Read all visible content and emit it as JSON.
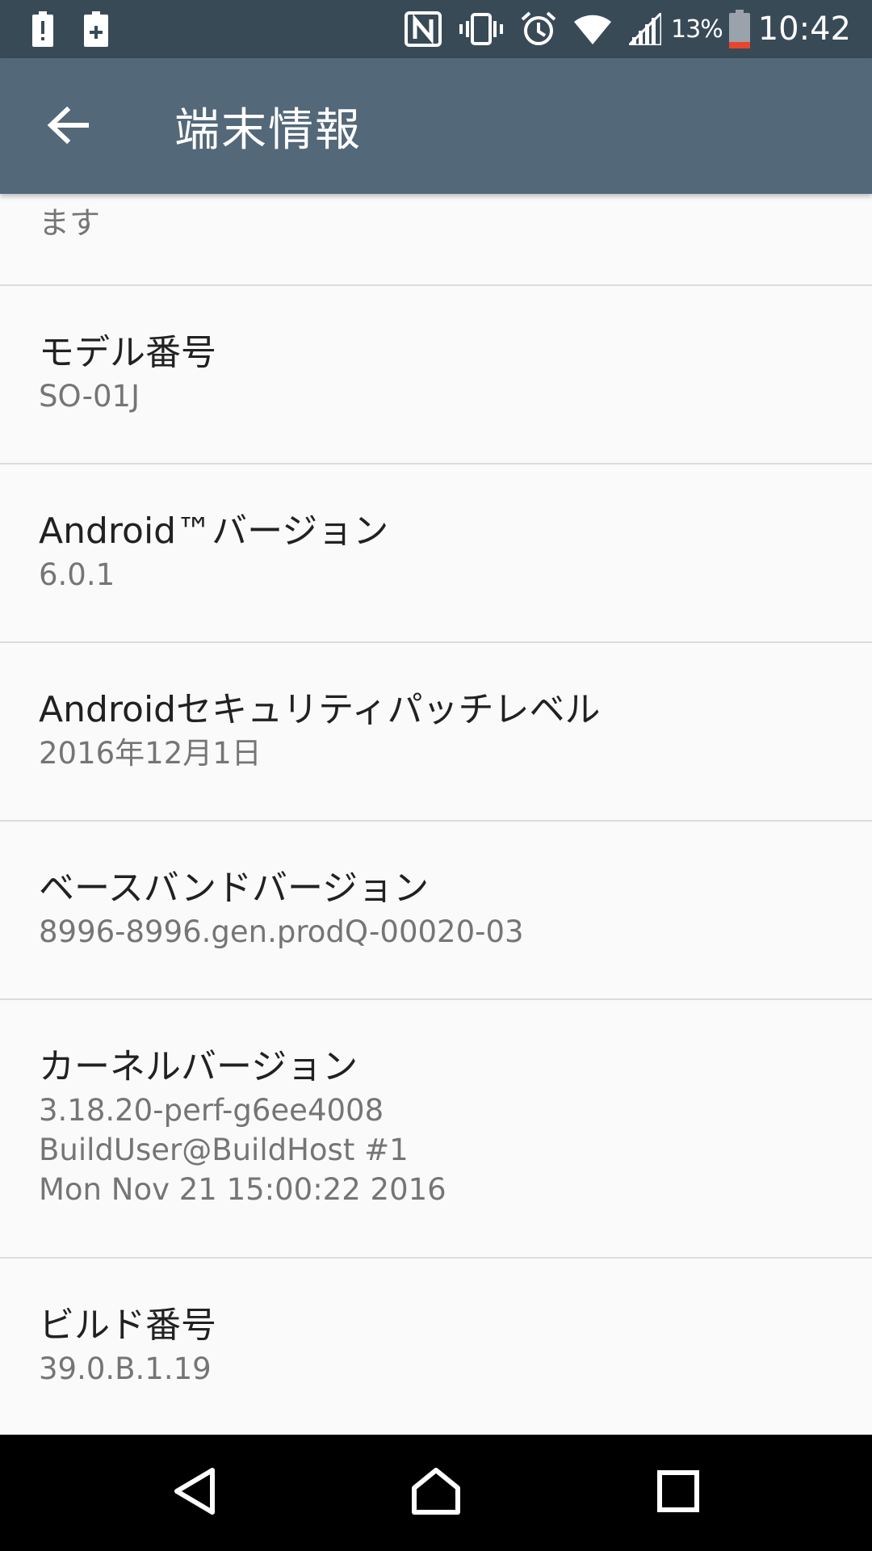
{
  "status_bar": {
    "left_icons": [
      "battery-alert-icon",
      "battery-plus-icon"
    ],
    "right_icons": [
      "nfc-icon",
      "vibrate-icon",
      "alarm-icon",
      "wifi-icon",
      "signal-icon"
    ],
    "battery_percent": "13%",
    "time": "10:42"
  },
  "app_bar": {
    "title": "端末情報",
    "back_icon": "arrow-back-icon"
  },
  "list": {
    "clipped_summary": "ます",
    "items": [
      {
        "title": "モデル番号",
        "summary": "SO-01J"
      },
      {
        "title": "Android™バージョン",
        "summary": "6.0.1"
      },
      {
        "title": "Androidセキュリティパッチレベル",
        "summary": "2016年12月1日"
      },
      {
        "title": "ベースバンドバージョン",
        "summary": "8996-8996.gen.prodQ-00020-03"
      },
      {
        "title": "カーネルバージョン",
        "summary_lines": [
          "3.18.20-perf-g6ee4008",
          "BuildUser@BuildHost #1",
          "Mon Nov 21 15:00:22 2016"
        ]
      },
      {
        "title": "ビルド番号",
        "summary": "39.0.B.1.19"
      }
    ]
  },
  "nav_bar": {
    "icons": [
      "nav-back-icon",
      "nav-home-icon",
      "nav-recents-icon"
    ]
  },
  "colors": {
    "status_bar": "#394a57",
    "app_bar": "#536879",
    "background": "#fafafa",
    "title_text": "#212121",
    "summary_text": "#757575",
    "battery_low": "#e8452c"
  }
}
